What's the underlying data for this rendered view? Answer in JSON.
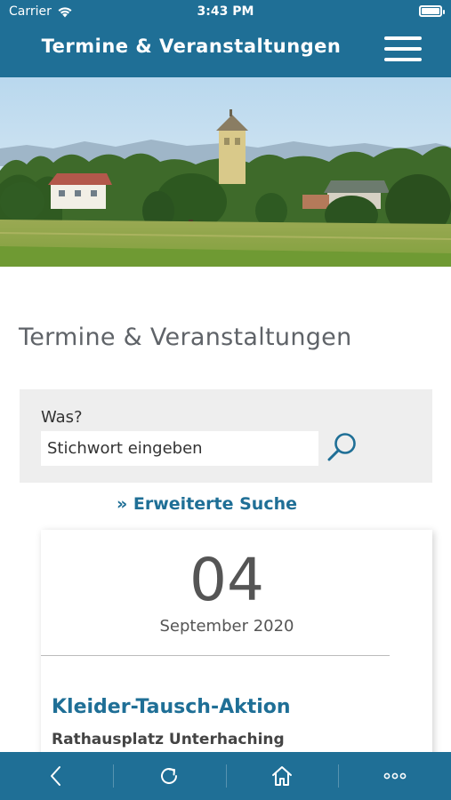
{
  "status_bar": {
    "carrier": "Carrier",
    "time": "3:43 PM",
    "battery_level": 1.0
  },
  "header": {
    "title": "Termine & Veranstaltungen",
    "menu_icon": "hamburger-menu-icon"
  },
  "hero": {
    "description_icon": "town-landscape-photo"
  },
  "main": {
    "section_title": "Termine & Veranstaltungen",
    "search": {
      "label": "Was?",
      "placeholder": "Stichwort eingeben",
      "value": "",
      "button_icon": "search-icon"
    },
    "advanced_search_link": "» Erweiterte Suche",
    "event": {
      "day": "04",
      "month_year": "September 2020",
      "title": "Kleider-Tausch-Aktion",
      "location": "Rathausplatz Unterhaching"
    }
  },
  "toolbar": {
    "items": [
      {
        "icon": "back-chevron-icon"
      },
      {
        "icon": "reload-icon"
      },
      {
        "icon": "home-icon"
      },
      {
        "icon": "more-dots-icon"
      }
    ]
  },
  "colors": {
    "brand_blue": "#1f6f96",
    "panel_gray": "#eeeeee",
    "text_gray": "#5f6368"
  }
}
